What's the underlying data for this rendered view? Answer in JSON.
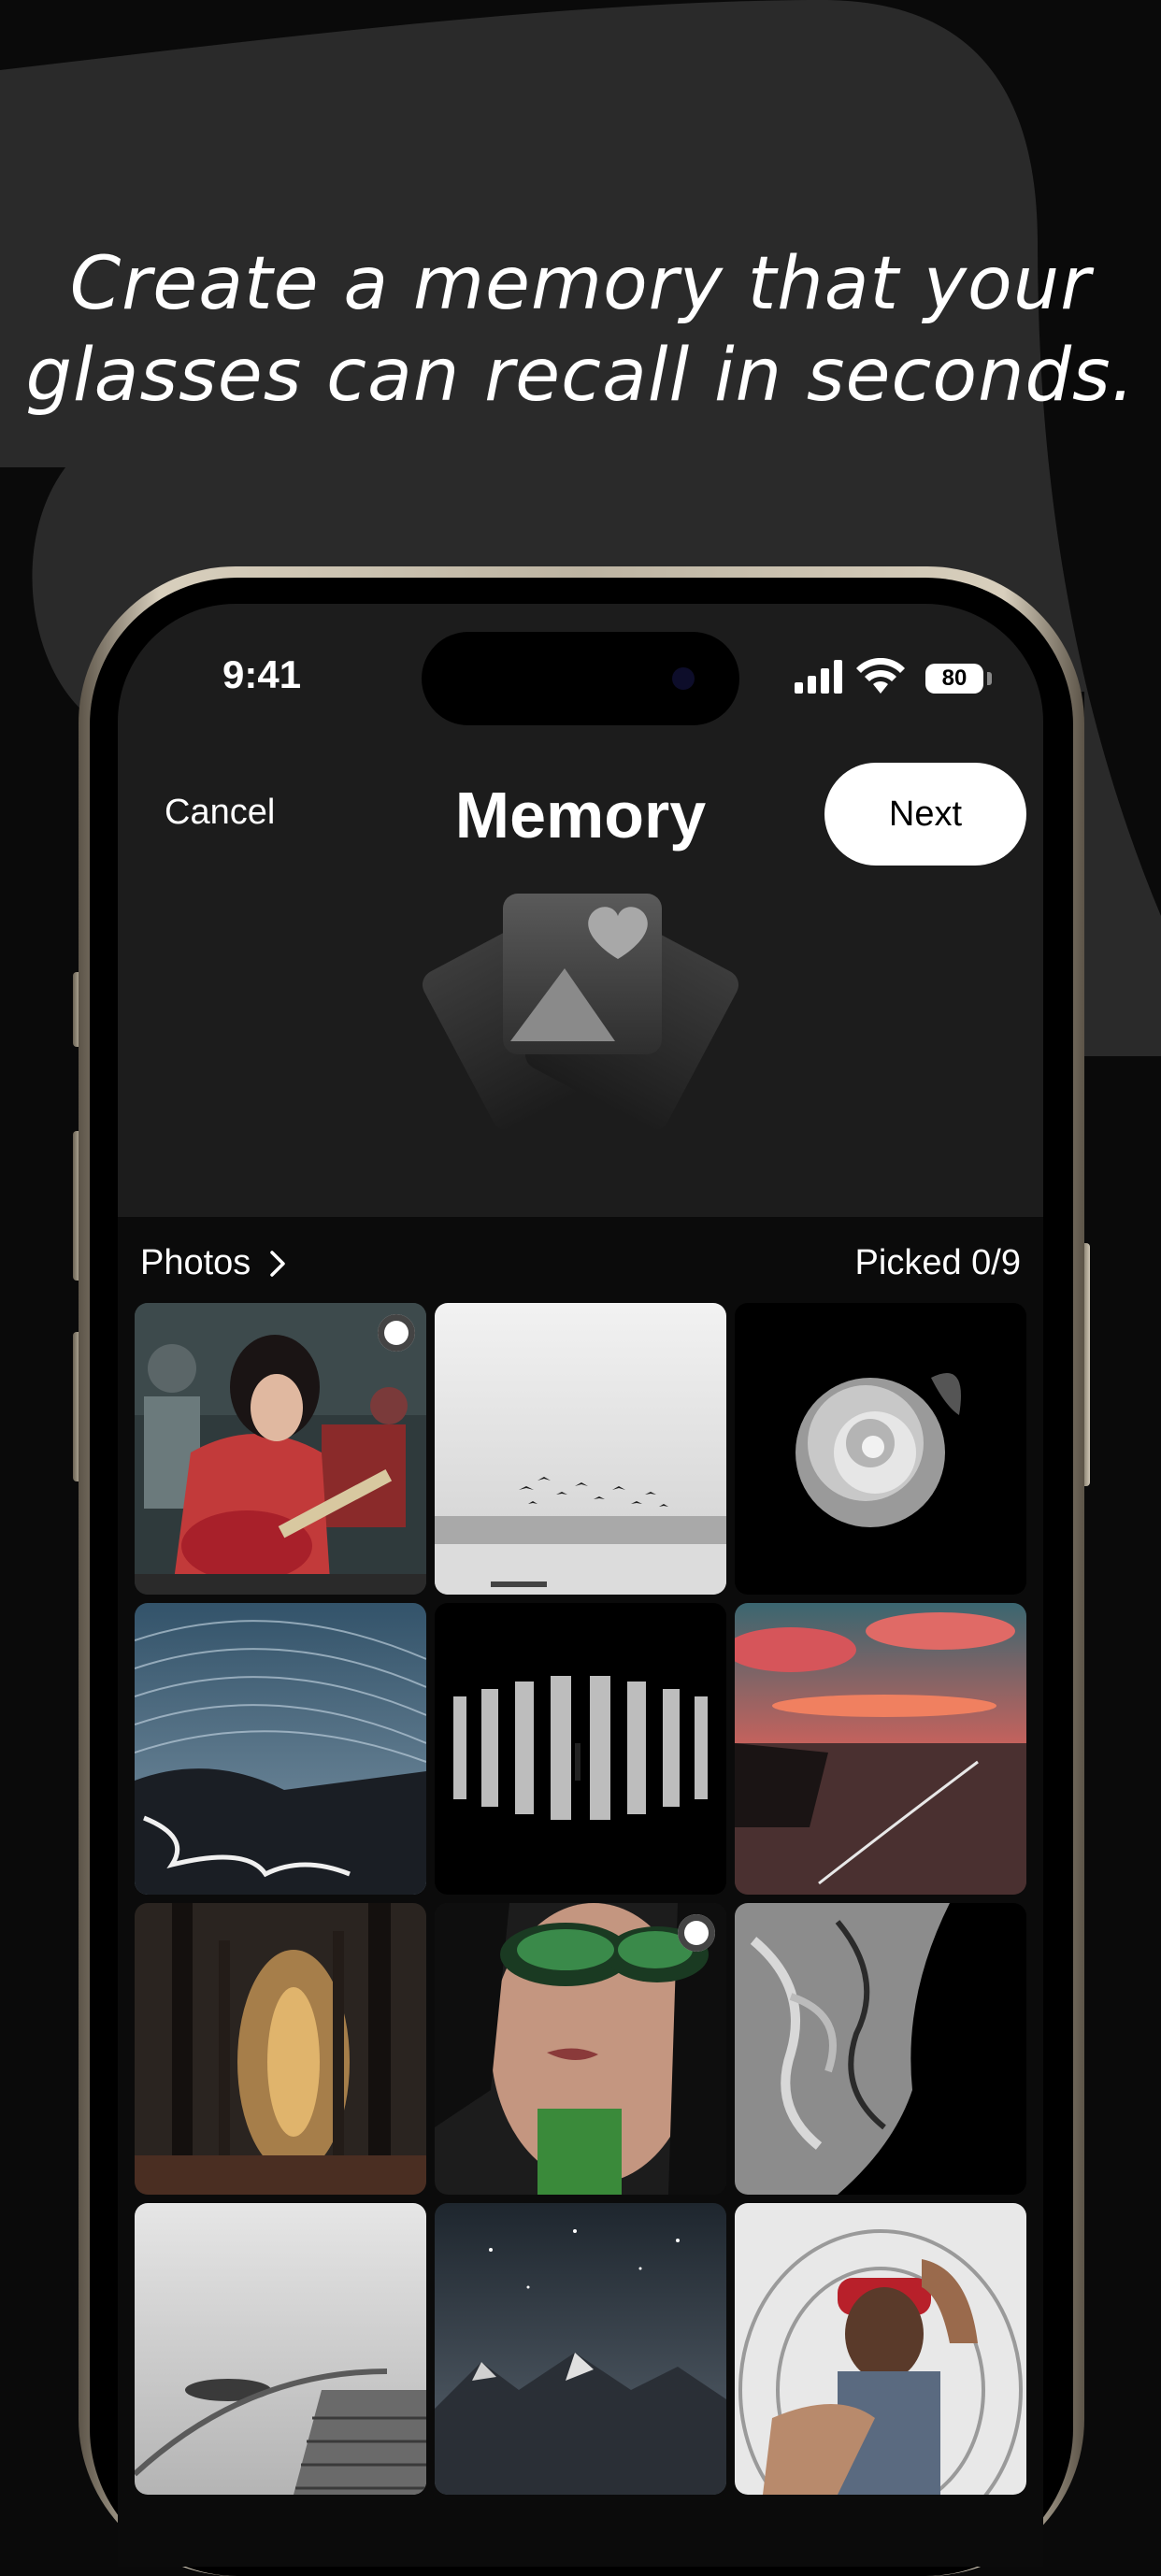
{
  "headline": {
    "line1": "Create a memory that your",
    "line2": "glasses can recall in seconds."
  },
  "status_bar": {
    "time": "9:41",
    "battery": "80",
    "icons": [
      "signal-icon",
      "wifi-icon",
      "battery-icon"
    ]
  },
  "nav": {
    "cancel_label": "Cancel",
    "title": "Memory",
    "next_label": "Next"
  },
  "hero": {
    "icon": "memory-photos-heart-icon"
  },
  "picker": {
    "source_label": "Photos",
    "source_icon": "chevron-right-icon",
    "picked_label": "Picked 0/9"
  },
  "photos": [
    {
      "subject": "guitar-player",
      "selectable": true
    },
    {
      "subject": "birds-over-lake",
      "selectable": false
    },
    {
      "subject": "white-rose",
      "selectable": false
    },
    {
      "subject": "star-trails-road",
      "selectable": false
    },
    {
      "subject": "light-corridor",
      "selectable": false
    },
    {
      "subject": "red-sunset-sea",
      "selectable": false
    },
    {
      "subject": "forest-path",
      "selectable": false
    },
    {
      "subject": "woman-green-glasses",
      "selectable": true
    },
    {
      "subject": "marble-swirl",
      "selectable": false
    },
    {
      "subject": "spiral-staircase",
      "selectable": false
    },
    {
      "subject": "mountain-night",
      "selectable": false
    },
    {
      "subject": "man-hand-frame",
      "selectable": false
    }
  ],
  "colors": {
    "background": "#0a0a0a",
    "shape": "#2a2a2a",
    "screen": "#1c1c1c",
    "accent": "#ffffff",
    "frame": "#c9c0ad"
  }
}
